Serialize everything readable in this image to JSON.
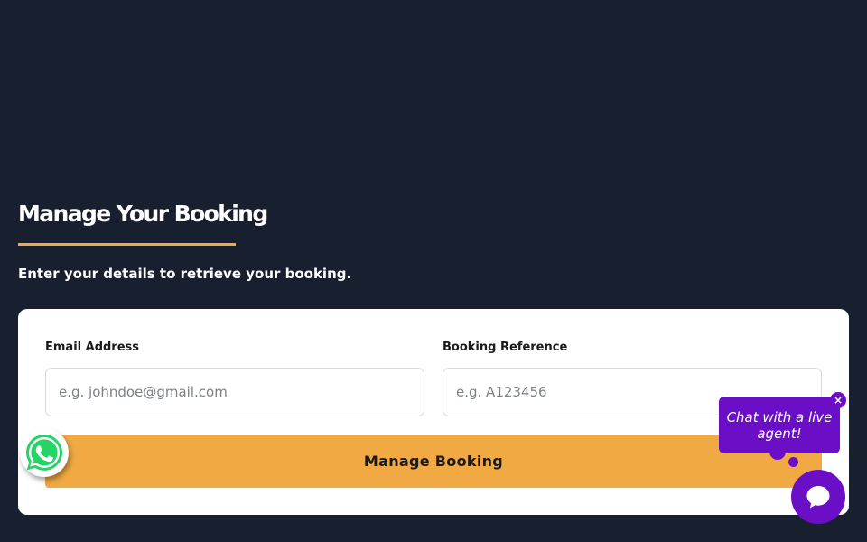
{
  "page": {
    "title": "Manage Your Booking",
    "subtitle": "Enter your details to retrieve your booking."
  },
  "form": {
    "email": {
      "label": "Email Address",
      "placeholder": "e.g. johndoe@gmail.com",
      "value": ""
    },
    "reference": {
      "label": "Booking Reference",
      "placeholder": "e.g. A123456",
      "value": ""
    },
    "submit_label": "Manage Booking"
  },
  "chat": {
    "bubble_text": "Chat with a live agent!",
    "close_glyph": "×",
    "launcher_icon": "chat-bubble-icon"
  },
  "whatsapp": {
    "icon": "whatsapp-icon"
  },
  "colors": {
    "background": "#182030",
    "accent": "#f0a943",
    "chat": "#6a0fc6",
    "whatsapp": "#25d366"
  }
}
